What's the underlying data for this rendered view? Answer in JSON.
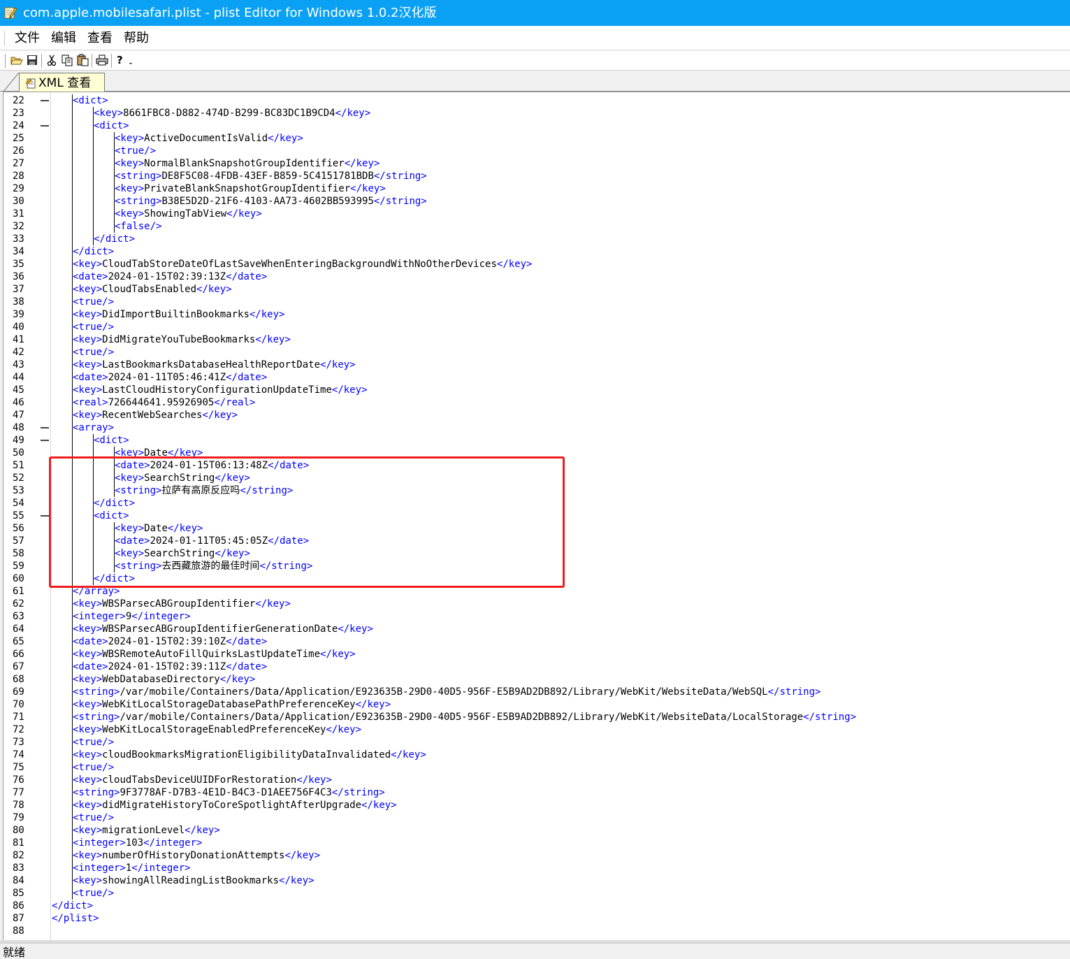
{
  "window": {
    "title": "com.apple.mobilesafari.plist - plist Editor for Windows 1.0.2汉化版",
    "icon": "notepad-pencil-icon",
    "titlebar_color": "#0aa1f5"
  },
  "menu": [
    "文件",
    "编辑",
    "查看",
    "帮助"
  ],
  "toolbar": {
    "buttons": [
      "open-icon",
      "save-icon",
      "cut-icon",
      "copy-icon",
      "paste-icon",
      "print-icon",
      "help-icon"
    ]
  },
  "tabs": [
    {
      "label": "XML 查看",
      "active": true,
      "icon": "xml-document-icon"
    }
  ],
  "editor": {
    "tag_color": "#0000ff",
    "text_color": "#000000",
    "highlight_color": "#ee1c1c",
    "highlighted_lines": [
      51,
      60
    ],
    "lines": [
      {
        "n": "22",
        "fold": true,
        "indent": 1,
        "parts": [
          [
            "t",
            "<dict>"
          ]
        ]
      },
      {
        "n": "23",
        "indent": 2,
        "parts": [
          [
            "t",
            "<key>"
          ],
          [
            "x",
            "8661FBC8-D882-474D-B299-BC83DC1B9CD4"
          ],
          [
            "t",
            "</key>"
          ]
        ]
      },
      {
        "n": "24",
        "fold": true,
        "indent": 2,
        "parts": [
          [
            "t",
            "<dict>"
          ]
        ]
      },
      {
        "n": "25",
        "indent": 3,
        "parts": [
          [
            "t",
            "<key>"
          ],
          [
            "x",
            "ActiveDocumentIsValid"
          ],
          [
            "t",
            "</key>"
          ]
        ]
      },
      {
        "n": "26",
        "indent": 3,
        "parts": [
          [
            "t",
            "<true/>"
          ]
        ]
      },
      {
        "n": "27",
        "indent": 3,
        "parts": [
          [
            "t",
            "<key>"
          ],
          [
            "x",
            "NormalBlankSnapshotGroupIdentifier"
          ],
          [
            "t",
            "</key>"
          ]
        ]
      },
      {
        "n": "28",
        "indent": 3,
        "parts": [
          [
            "t",
            "<string>"
          ],
          [
            "x",
            "DE8F5C08-4FDB-43EF-B859-5C4151781BDB"
          ],
          [
            "t",
            "</string>"
          ]
        ]
      },
      {
        "n": "29",
        "indent": 3,
        "parts": [
          [
            "t",
            "<key>"
          ],
          [
            "x",
            "PrivateBlankSnapshotGroupIdentifier"
          ],
          [
            "t",
            "</key>"
          ]
        ]
      },
      {
        "n": "30",
        "indent": 3,
        "parts": [
          [
            "t",
            "<string>"
          ],
          [
            "x",
            "B38E5D2D-21F6-4103-AA73-4602BB593995"
          ],
          [
            "t",
            "</string>"
          ]
        ]
      },
      {
        "n": "31",
        "indent": 3,
        "parts": [
          [
            "t",
            "<key>"
          ],
          [
            "x",
            "ShowingTabView"
          ],
          [
            "t",
            "</key>"
          ]
        ]
      },
      {
        "n": "32",
        "indent": 3,
        "parts": [
          [
            "t",
            "<false/>"
          ]
        ]
      },
      {
        "n": "33",
        "indent": 2,
        "parts": [
          [
            "t",
            "</dict>"
          ]
        ]
      },
      {
        "n": "34",
        "indent": 1,
        "parts": [
          [
            "t",
            "</dict>"
          ]
        ]
      },
      {
        "n": "35",
        "indent": 1,
        "parts": [
          [
            "t",
            "<key>"
          ],
          [
            "x",
            "CloudTabStoreDateOfLastSaveWhenEnteringBackgroundWithNoOtherDevices"
          ],
          [
            "t",
            "</key>"
          ]
        ]
      },
      {
        "n": "36",
        "indent": 1,
        "parts": [
          [
            "t",
            "<date>"
          ],
          [
            "x",
            "2024-01-15T02:39:13Z"
          ],
          [
            "t",
            "</date>"
          ]
        ]
      },
      {
        "n": "37",
        "indent": 1,
        "parts": [
          [
            "t",
            "<key>"
          ],
          [
            "x",
            "CloudTabsEnabled"
          ],
          [
            "t",
            "</key>"
          ]
        ]
      },
      {
        "n": "38",
        "indent": 1,
        "parts": [
          [
            "t",
            "<true/>"
          ]
        ]
      },
      {
        "n": "39",
        "indent": 1,
        "parts": [
          [
            "t",
            "<key>"
          ],
          [
            "x",
            "DidImportBuiltinBookmarks"
          ],
          [
            "t",
            "</key>"
          ]
        ]
      },
      {
        "n": "40",
        "indent": 1,
        "parts": [
          [
            "t",
            "<true/>"
          ]
        ]
      },
      {
        "n": "41",
        "indent": 1,
        "parts": [
          [
            "t",
            "<key>"
          ],
          [
            "x",
            "DidMigrateYouTubeBookmarks"
          ],
          [
            "t",
            "</key>"
          ]
        ]
      },
      {
        "n": "42",
        "indent": 1,
        "parts": [
          [
            "t",
            "<true/>"
          ]
        ]
      },
      {
        "n": "43",
        "indent": 1,
        "parts": [
          [
            "t",
            "<key>"
          ],
          [
            "x",
            "LastBookmarksDatabaseHealthReportDate"
          ],
          [
            "t",
            "</key>"
          ]
        ]
      },
      {
        "n": "44",
        "indent": 1,
        "parts": [
          [
            "t",
            "<date>"
          ],
          [
            "x",
            "2024-01-11T05:46:41Z"
          ],
          [
            "t",
            "</date>"
          ]
        ]
      },
      {
        "n": "45",
        "indent": 1,
        "parts": [
          [
            "t",
            "<key>"
          ],
          [
            "x",
            "LastCloudHistoryConfigurationUpdateTime"
          ],
          [
            "t",
            "</key>"
          ]
        ]
      },
      {
        "n": "46",
        "indent": 1,
        "parts": [
          [
            "t",
            "<real>"
          ],
          [
            "x",
            "726644641.95926905"
          ],
          [
            "t",
            "</real>"
          ]
        ]
      },
      {
        "n": "47",
        "indent": 1,
        "parts": [
          [
            "t",
            "<key>"
          ],
          [
            "x",
            "RecentWebSearches"
          ],
          [
            "t",
            "</key>"
          ]
        ]
      },
      {
        "n": "48",
        "fold": true,
        "indent": 1,
        "parts": [
          [
            "t",
            "<array>"
          ]
        ]
      },
      {
        "n": "49",
        "fold": true,
        "indent": 2,
        "parts": [
          [
            "t",
            "<dict>"
          ]
        ]
      },
      {
        "n": "50",
        "indent": 3,
        "parts": [
          [
            "t",
            "<key>"
          ],
          [
            "x",
            "Date"
          ],
          [
            "t",
            "</key>"
          ]
        ]
      },
      {
        "n": "51",
        "indent": 3,
        "parts": [
          [
            "t",
            "<date>"
          ],
          [
            "x",
            "2024-01-15T06:13:48Z"
          ],
          [
            "t",
            "</date>"
          ]
        ]
      },
      {
        "n": "52",
        "indent": 3,
        "parts": [
          [
            "t",
            "<key>"
          ],
          [
            "x",
            "SearchString"
          ],
          [
            "t",
            "</key>"
          ]
        ]
      },
      {
        "n": "53",
        "indent": 3,
        "parts": [
          [
            "t",
            "<string>"
          ],
          [
            "x",
            "拉萨有高原反应吗"
          ],
          [
            "t",
            "</string>"
          ]
        ]
      },
      {
        "n": "54",
        "indent": 2,
        "parts": [
          [
            "t",
            "</dict>"
          ]
        ]
      },
      {
        "n": "55",
        "fold": true,
        "indent": 2,
        "parts": [
          [
            "t",
            "<dict>"
          ]
        ]
      },
      {
        "n": "56",
        "indent": 3,
        "parts": [
          [
            "t",
            "<key>"
          ],
          [
            "x",
            "Date"
          ],
          [
            "t",
            "</key>"
          ]
        ]
      },
      {
        "n": "57",
        "indent": 3,
        "parts": [
          [
            "t",
            "<date>"
          ],
          [
            "x",
            "2024-01-11T05:45:05Z"
          ],
          [
            "t",
            "</date>"
          ]
        ]
      },
      {
        "n": "58",
        "indent": 3,
        "parts": [
          [
            "t",
            "<key>"
          ],
          [
            "x",
            "SearchString"
          ],
          [
            "t",
            "</key>"
          ]
        ]
      },
      {
        "n": "59",
        "indent": 3,
        "parts": [
          [
            "t",
            "<string>"
          ],
          [
            "x",
            "去西藏旅游的最佳时间"
          ],
          [
            "t",
            "</string>"
          ]
        ]
      },
      {
        "n": "60",
        "indent": 2,
        "parts": [
          [
            "t",
            "</dict>"
          ]
        ]
      },
      {
        "n": "61",
        "indent": 1,
        "parts": [
          [
            "t",
            "</array>"
          ]
        ]
      },
      {
        "n": "62",
        "indent": 1,
        "parts": [
          [
            "t",
            "<key>"
          ],
          [
            "x",
            "WBSParsecABGroupIdentifier"
          ],
          [
            "t",
            "</key>"
          ]
        ]
      },
      {
        "n": "63",
        "indent": 1,
        "parts": [
          [
            "t",
            "<integer>"
          ],
          [
            "x",
            "9"
          ],
          [
            "t",
            "</integer>"
          ]
        ]
      },
      {
        "n": "64",
        "indent": 1,
        "parts": [
          [
            "t",
            "<key>"
          ],
          [
            "x",
            "WBSParsecABGroupIdentifierGenerationDate"
          ],
          [
            "t",
            "</key>"
          ]
        ]
      },
      {
        "n": "65",
        "indent": 1,
        "parts": [
          [
            "t",
            "<date>"
          ],
          [
            "x",
            "2024-01-15T02:39:10Z"
          ],
          [
            "t",
            "</date>"
          ]
        ]
      },
      {
        "n": "66",
        "indent": 1,
        "parts": [
          [
            "t",
            "<key>"
          ],
          [
            "x",
            "WBSRemoteAutoFillQuirksLastUpdateTime"
          ],
          [
            "t",
            "</key>"
          ]
        ]
      },
      {
        "n": "67",
        "indent": 1,
        "parts": [
          [
            "t",
            "<date>"
          ],
          [
            "x",
            "2024-01-15T02:39:11Z"
          ],
          [
            "t",
            "</date>"
          ]
        ]
      },
      {
        "n": "68",
        "indent": 1,
        "parts": [
          [
            "t",
            "<key>"
          ],
          [
            "x",
            "WebDatabaseDirectory"
          ],
          [
            "t",
            "</key>"
          ]
        ]
      },
      {
        "n": "69",
        "indent": 1,
        "parts": [
          [
            "t",
            "<string>"
          ],
          [
            "x",
            "/var/mobile/Containers/Data/Application/E923635B-29D0-40D5-956F-E5B9AD2DB892/Library/WebKit/WebsiteData/WebSQL"
          ],
          [
            "t",
            "</string>"
          ]
        ]
      },
      {
        "n": "70",
        "indent": 1,
        "parts": [
          [
            "t",
            "<key>"
          ],
          [
            "x",
            "WebKitLocalStorageDatabasePathPreferenceKey"
          ],
          [
            "t",
            "</key>"
          ]
        ]
      },
      {
        "n": "71",
        "indent": 1,
        "parts": [
          [
            "t",
            "<string>"
          ],
          [
            "x",
            "/var/mobile/Containers/Data/Application/E923635B-29D0-40D5-956F-E5B9AD2DB892/Library/WebKit/WebsiteData/LocalStorage"
          ],
          [
            "t",
            "</string>"
          ]
        ]
      },
      {
        "n": "72",
        "indent": 1,
        "parts": [
          [
            "t",
            "<key>"
          ],
          [
            "x",
            "WebKitLocalStorageEnabledPreferenceKey"
          ],
          [
            "t",
            "</key>"
          ]
        ]
      },
      {
        "n": "73",
        "indent": 1,
        "parts": [
          [
            "t",
            "<true/>"
          ]
        ]
      },
      {
        "n": "74",
        "indent": 1,
        "parts": [
          [
            "t",
            "<key>"
          ],
          [
            "x",
            "cloudBookmarksMigrationEligibilityDataInvalidated"
          ],
          [
            "t",
            "</key>"
          ]
        ]
      },
      {
        "n": "75",
        "indent": 1,
        "parts": [
          [
            "t",
            "<true/>"
          ]
        ]
      },
      {
        "n": "76",
        "indent": 1,
        "parts": [
          [
            "t",
            "<key>"
          ],
          [
            "x",
            "cloudTabsDeviceUUIDForRestoration"
          ],
          [
            "t",
            "</key>"
          ]
        ]
      },
      {
        "n": "77",
        "indent": 1,
        "parts": [
          [
            "t",
            "<string>"
          ],
          [
            "x",
            "9F3778AF-D7B3-4E1D-B4C3-D1AEE756F4C3"
          ],
          [
            "t",
            "</string>"
          ]
        ]
      },
      {
        "n": "78",
        "indent": 1,
        "parts": [
          [
            "t",
            "<key>"
          ],
          [
            "x",
            "didMigrateHistoryToCoreSpotlightAfterUpgrade"
          ],
          [
            "t",
            "</key>"
          ]
        ]
      },
      {
        "n": "79",
        "indent": 1,
        "parts": [
          [
            "t",
            "<true/>"
          ]
        ]
      },
      {
        "n": "80",
        "indent": 1,
        "parts": [
          [
            "t",
            "<key>"
          ],
          [
            "x",
            "migrationLevel"
          ],
          [
            "t",
            "</key>"
          ]
        ]
      },
      {
        "n": "81",
        "indent": 1,
        "parts": [
          [
            "t",
            "<integer>"
          ],
          [
            "x",
            "103"
          ],
          [
            "t",
            "</integer>"
          ]
        ]
      },
      {
        "n": "82",
        "indent": 1,
        "parts": [
          [
            "t",
            "<key>"
          ],
          [
            "x",
            "numberOfHistoryDonationAttempts"
          ],
          [
            "t",
            "</key>"
          ]
        ]
      },
      {
        "n": "83",
        "indent": 1,
        "parts": [
          [
            "t",
            "<integer>"
          ],
          [
            "x",
            "1"
          ],
          [
            "t",
            "</integer>"
          ]
        ]
      },
      {
        "n": "84",
        "indent": 1,
        "parts": [
          [
            "t",
            "<key>"
          ],
          [
            "x",
            "showingAllReadingListBookmarks"
          ],
          [
            "t",
            "</key>"
          ]
        ]
      },
      {
        "n": "85",
        "indent": 1,
        "parts": [
          [
            "t",
            "<true/>"
          ]
        ]
      },
      {
        "n": "86",
        "indent": 0,
        "parts": [
          [
            "t",
            "</dict>"
          ]
        ]
      },
      {
        "n": "87",
        "indent": 0,
        "parts": [
          [
            "t",
            "</plist>"
          ]
        ]
      },
      {
        "n": "88",
        "indent": 0,
        "parts": []
      }
    ]
  },
  "status": {
    "text": "就绪"
  }
}
